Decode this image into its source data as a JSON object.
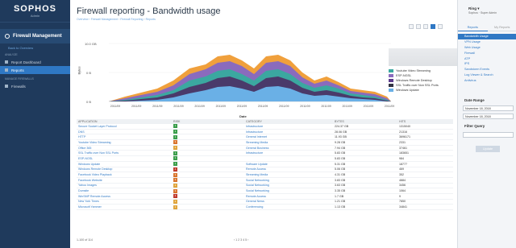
{
  "sidebar": {
    "brand": "SOPHOS",
    "brand_sub": "Admin",
    "section_title": "Firewall Management",
    "back_link": "Back to Overview",
    "group_analyze": "ANALYZE",
    "items": [
      {
        "label": "Report Dashboard"
      },
      {
        "label": "Reports"
      }
    ],
    "group_manage": "MANAGE FIREWALLS",
    "item_firewalls": "Firewalls"
  },
  "header": {
    "title": "Firewall reporting - Bandwidth usage",
    "breadcrumb": "Overview › Firewall Management › Firewall Reporting › Reports"
  },
  "chart": {
    "y_ticks": [
      "10.0 GB",
      "0 B",
      "0 B"
    ],
    "x_ticks": [
      "2011/09",
      "2011/09",
      "2011/09",
      "2011/09",
      "2011/09",
      "2011/09",
      "2011/09",
      "2011/09",
      "2011/09",
      "2011/09",
      "2011/09",
      "2011/09",
      "2011/09",
      "2011/09"
    ],
    "xlabel": "Date",
    "ylabel": "Bytes",
    "legend": [
      {
        "name": "Youtube Video Streaming",
        "color": "#3ba8a0"
      },
      {
        "name": "ESP-NGSL",
        "color": "#8a6bbd"
      },
      {
        "name": "Windows Remote Desktop",
        "color": "#5b3b8c"
      },
      {
        "name": "SSL Traffic over Non SSL Ports",
        "color": "#333344"
      },
      {
        "name": "Windows Update",
        "color": "#6ab0e6"
      }
    ]
  },
  "table": {
    "headers": [
      "APPLICATION",
      "RISK",
      "CATEGORY",
      "BYTES",
      "HITS"
    ],
    "rows": [
      {
        "app": "Secure Socket Layer Protocol",
        "risk": "1",
        "cat": "Infrastructure",
        "bytes": "224.37 GB",
        "hits": "1315040"
      },
      {
        "app": "DNS",
        "risk": "1",
        "cat": "Infrastructure",
        "bytes": "28.06 GB",
        "hits": "21316"
      },
      {
        "app": "HTTP",
        "risk": "1",
        "cat": "General Internet",
        "bytes": "11.93 GB",
        "hits": "3696171"
      },
      {
        "app": "Youtube Video Streaming",
        "risk": "3",
        "cat": "Streaming Media",
        "bytes": "9.28 GB",
        "hits": "2331"
      },
      {
        "app": "Office 365",
        "risk": "2",
        "cat": "General Business",
        "bytes": "7.94 GB",
        "hits": "37461"
      },
      {
        "app": "SSL Traffic over Non SSL Ports",
        "risk": "1",
        "cat": "Infrastructure",
        "bytes": "5.83 GB",
        "hits": "183651"
      },
      {
        "app": "ESP-NGSL",
        "risk": "1",
        "cat": "",
        "bytes": "5.83 GB",
        "hits": "984"
      },
      {
        "app": "Windows Update",
        "risk": "1",
        "cat": "Software Update",
        "bytes": "5.31 GB",
        "hits": "18777"
      },
      {
        "app": "Windows Remote Desktop",
        "risk": "4",
        "cat": "Remote Access",
        "bytes": "5.06 GB",
        "hits": "469"
      },
      {
        "app": "Facebook Video Playback",
        "risk": "3",
        "cat": "Streaming Media",
        "bytes": "4.31 GB",
        "hits": "352"
      },
      {
        "app": "Facebook Website",
        "risk": "3",
        "cat": "Social Networking",
        "bytes": "3.83 GB",
        "hits": "4884"
      },
      {
        "app": "Yahoo Images",
        "risk": "2",
        "cat": "Social Networking",
        "bytes": "3.63 GB",
        "hits": "3456"
      },
      {
        "app": "Dumsite",
        "risk": "3",
        "cat": "Social Networking",
        "bytes": "3.35 GB",
        "hits": "1064"
      },
      {
        "app": "WinSMP Remote Access",
        "risk": "4",
        "cat": "Remote Access",
        "bytes": "1.7 GB",
        "hits": "9"
      },
      {
        "app": "New York Times",
        "risk": "2",
        "cat": "General News",
        "bytes": "1.21 GB",
        "hits": "7850"
      },
      {
        "app": "Microsoft Yammer",
        "risk": "2",
        "cat": "Conferencing",
        "bytes": "1.13 GB",
        "hits": "34841"
      }
    ],
    "count": "1-100 of 114",
    "pager": "‹ 1 2 3 4 5 ›"
  },
  "right": {
    "user": "Ring ▾",
    "user_sub": "Sophos · Super Admin",
    "tabs": [
      "Reports",
      "My Reports"
    ],
    "reports": [
      "Bandwidth Usage",
      "VPN Usage",
      "Web Usage",
      "Firewall",
      "ATP",
      "IPS",
      "Sandstorm Events",
      "Log Viewer & Search",
      "Antivirus"
    ],
    "date_range_label": "Date Range",
    "date_from": "November 18, 2018",
    "date_to": "November 18, 2018",
    "filter_label": "Filter Query",
    "update_button": "Update"
  },
  "colors": {
    "accent": "#2f78c4",
    "sidebar": "#1f3a5c"
  }
}
